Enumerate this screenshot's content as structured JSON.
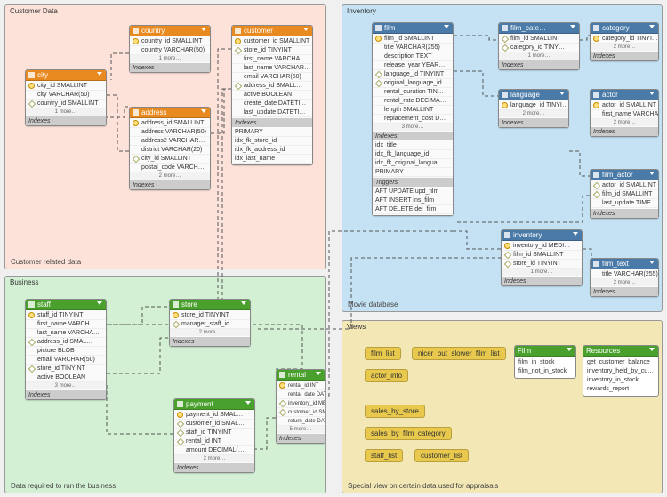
{
  "groups": {
    "customer": {
      "label": "Customer Data",
      "caption": "Customer related data"
    },
    "inventory": {
      "label": "Inventory",
      "caption": "Movie database"
    },
    "business": {
      "label": "Business",
      "caption": "Data required to run the business"
    },
    "views": {
      "label": "Views",
      "caption": "Special view on certain data used for appraisals"
    }
  },
  "section_labels": {
    "indexes": "Indexes",
    "indexes_h": "Indexes",
    "triggers": "Triggers"
  },
  "more_labels": {
    "m1": "1 more…",
    "m2": "2 more…",
    "m3": "3 more…",
    "m5": "5 more…"
  },
  "tables": {
    "country": {
      "name": "country",
      "cols": [
        [
          "pk",
          "country_id SMALLINT"
        ],
        [
          "",
          "country VARCHAR(50)"
        ]
      ]
    },
    "city": {
      "name": "city",
      "cols": [
        [
          "pk",
          "city_id SMALLINT"
        ],
        [
          "",
          "city VARCHAR(50)"
        ],
        [
          "fk",
          "country_id SMALLINT"
        ]
      ]
    },
    "address": {
      "name": "address",
      "cols": [
        [
          "pk",
          "address_id SMALLINT"
        ],
        [
          "",
          "address VARCHAR(50)"
        ],
        [
          "",
          "address2 VARCHAR…"
        ],
        [
          "",
          "district VARCHAR(20)"
        ],
        [
          "fk",
          "city_id SMALLINT"
        ],
        [
          "",
          "postal_code VARCH…"
        ]
      ]
    },
    "customer": {
      "name": "customer",
      "cols": [
        [
          "pk",
          "customer_id SMALLINT"
        ],
        [
          "fk",
          "store_id TINYINT"
        ],
        [
          "",
          "first_name VARCHA…"
        ],
        [
          "",
          "last_name VARCHAR…"
        ],
        [
          "",
          "email VARCHAR(50)"
        ],
        [
          "fk",
          "address_id SMALL…"
        ],
        [
          "",
          "active BOOLEAN"
        ],
        [
          "",
          "create_date DATETI…"
        ],
        [
          "",
          "last_update DATETI…"
        ]
      ],
      "indexes": [
        "PRIMARY",
        "idx_fk_store_id",
        "idx_fk_address_id",
        "idx_last_name"
      ]
    },
    "film": {
      "name": "film",
      "cols": [
        [
          "pk",
          "film_id SMALLINT"
        ],
        [
          "",
          "title VARCHAR(255)"
        ],
        [
          "",
          "description TEXT"
        ],
        [
          "",
          "release_year YEAR…"
        ],
        [
          "fk",
          "language_id TINYINT"
        ],
        [
          "fk",
          "original_language_id…"
        ],
        [
          "",
          "rental_duration TIN…"
        ],
        [
          "",
          "rental_rate DECIMA…"
        ],
        [
          "",
          "length SMALLINT"
        ],
        [
          "",
          "replacement_cost D…"
        ]
      ],
      "indexes": [
        "idx_title",
        "idx_fk_language_id",
        "idx_fk_original_langua…",
        "PRIMARY"
      ],
      "triggers": [
        "AFT UPDATE upd_film",
        "AFT INSERT ins_film",
        "AFT DELETE del_film"
      ]
    },
    "film_cate": {
      "name": "film_cate…",
      "cols": [
        [
          "fk",
          "film_id SMALLINT"
        ],
        [
          "fk",
          "category_id TINY…"
        ]
      ]
    },
    "category": {
      "name": "category",
      "cols": [
        [
          "pk",
          "category_id TINYI…"
        ]
      ]
    },
    "language": {
      "name": "language",
      "cols": [
        [
          "pk",
          "language_id TINYI…"
        ]
      ]
    },
    "actor": {
      "name": "actor",
      "cols": [
        [
          "pk",
          "actor_id SMALLINT"
        ],
        [
          "",
          "first_name VARCHA…"
        ]
      ]
    },
    "film_actor": {
      "name": "film_actor",
      "cols": [
        [
          "fk",
          "actor_id SMALLINT"
        ],
        [
          "fk",
          "film_id SMALLINT"
        ],
        [
          "",
          "last_update TIME…"
        ]
      ]
    },
    "inventory": {
      "name": "inventory",
      "cols": [
        [
          "pk",
          "inventory_id MEDI…"
        ],
        [
          "fk",
          "film_id SMALLINT"
        ],
        [
          "fk",
          "store_id TINYINT"
        ]
      ]
    },
    "film_text": {
      "name": "film_text",
      "cols": [
        [
          "",
          "title VARCHAR(255)"
        ]
      ]
    },
    "staff": {
      "name": "staff",
      "cols": [
        [
          "pk",
          "staff_id TINYINT"
        ],
        [
          "",
          "first_name VARCH…"
        ],
        [
          "",
          "last_name VARCHA…"
        ],
        [
          "fk",
          "address_id SMAL…"
        ],
        [
          "",
          "picture BLOB"
        ],
        [
          "",
          "email VARCHAR(50)"
        ],
        [
          "fk",
          "store_id TINYINT"
        ],
        [
          "",
          "active BOOLEAN"
        ]
      ]
    },
    "store": {
      "name": "store",
      "cols": [
        [
          "pk",
          "store_id TINYINT"
        ],
        [
          "fk",
          "manager_staff_id …"
        ]
      ]
    },
    "payment": {
      "name": "payment",
      "cols": [
        [
          "pk",
          "payment_id SMAL…"
        ],
        [
          "fk",
          "customer_id SMAL…"
        ],
        [
          "fk",
          "staff_id TINYINT"
        ],
        [
          "fk",
          "rental_id INT"
        ],
        [
          "",
          "amount DECIMAL(…"
        ]
      ]
    },
    "rental": {
      "name": "rental",
      "cols": [
        [
          "pk",
          "rental_id INT"
        ],
        [
          "",
          "rental_date DATE…"
        ],
        [
          "fk",
          "inventory_id MED…"
        ],
        [
          "fk",
          "customer_id SMAL…"
        ],
        [
          "",
          "return_date DATE…"
        ]
      ]
    }
  },
  "views_pills": {
    "film_list": "film_list",
    "nicer": "nicer_but_slower_film_list",
    "actor_info": "actor_info",
    "sales_store": "sales_by_store",
    "sales_cat": "sales_by_film_category",
    "staff_list": "staff_list",
    "customer_list": "customer_list"
  },
  "routine_boxes": {
    "Film": {
      "name": "Film",
      "items": [
        "film_in_stock",
        "film_not_in_stock"
      ]
    },
    "Resources": {
      "name": "Resources",
      "items": [
        "get_customer_balance",
        "inventory_held_by_cu…",
        "inventory_in_stock…",
        "rewards_report"
      ]
    }
  }
}
